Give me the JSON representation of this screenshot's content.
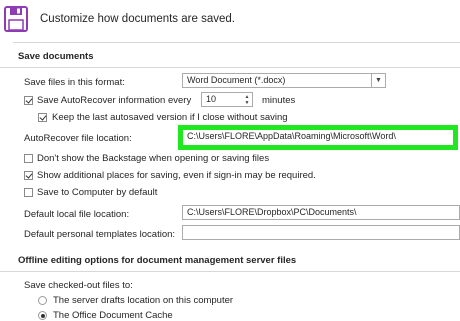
{
  "header": {
    "title": "Customize how documents are saved."
  },
  "save_documents": {
    "section_title": "Save documents",
    "format_label": "Save files in this format:",
    "format_value": "Word Document (*.docx)",
    "autorecover_label": "Save AutoRecover information every",
    "autorecover_checked": true,
    "autorecover_minutes": "10",
    "minutes_label": "minutes",
    "keep_last_label": "Keep the last autosaved version if I close without saving",
    "keep_last_checked": true,
    "autorecover_location_label": "AutoRecover file location:",
    "autorecover_location_value": "C:\\Users\\FLORE\\AppData\\Roaming\\Microsoft\\Word\\",
    "dont_show_backstage_label": "Don't show the Backstage when opening or saving files",
    "dont_show_backstage_checked": false,
    "show_additional_label": "Show additional places for saving, even if sign-in may be required.",
    "show_additional_checked": true,
    "save_to_computer_label": "Save to Computer by default",
    "save_to_computer_checked": false,
    "default_local_label": "Default local file location:",
    "default_local_value": "C:\\Users\\FLORE\\Dropbox\\PC\\Documents\\",
    "default_templates_label": "Default personal templates location:",
    "default_templates_value": ""
  },
  "offline": {
    "section_title": "Offline editing options for document management server files",
    "checked_out_label": "Save checked-out files to:",
    "radio_server": "The server drafts location on this computer",
    "radio_cache": "The Office Document Cache",
    "selected": "cache"
  },
  "colors": {
    "highlight": "#20e820",
    "icon": "#8f3cb4"
  }
}
